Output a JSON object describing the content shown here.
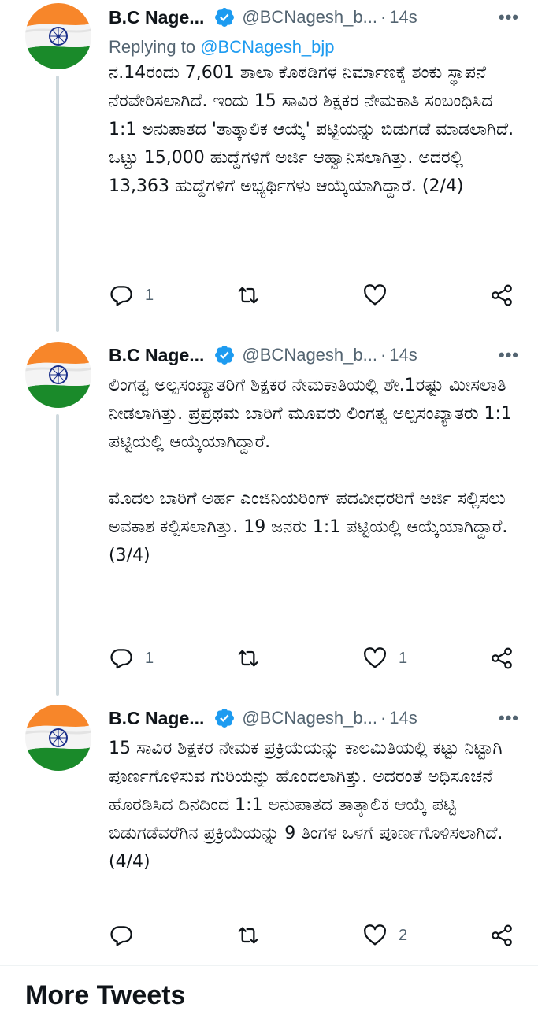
{
  "tweets": [
    {
      "name": "B.C Nage...",
      "handle": "@BCNagesh_b...",
      "separator": "·",
      "time": "14s",
      "more": "•••",
      "replying_prefix": "Replying to",
      "replying_handle": "@BCNagesh_bjp",
      "text": "ನ.14ರಂದು 7,601 ಶಾಲಾ ಕೊಠಡಿಗಳ ನಿರ್ಮಾಣಕ್ಕೆ ಶಂಕು ಸ್ಥಾಪನೆ ನೆರವೇರಿಸಲಾಗಿದೆ. ಇಂದು 15 ಸಾವಿರ ಶಿಕ್ಷಕರ ನೇಮಕಾತಿ ಸಂಬಂಧಿಸಿದ 1:1 ಅನುಪಾತದ 'ತಾತ್ಕಾಲಿಕ ಆಯ್ಕೆ' ಪಟ್ಟಿಯನ್ನು ಬಿಡುಗಡೆ ಮಾಡಲಾಗಿದೆ. ಒಟ್ಟು 15,000 ಹುದ್ದೆಗಳಿಗೆ ಅರ್ಜಿ ಆಹ್ವಾನಿಸಲಾಗಿತ್ತು. ಅದರಲ್ಲಿ 13,363 ಹುದ್ದೆಗಳಿಗೆ ಅಭ್ಯರ್ಥಿಗಳು ಆಯ್ಕೆಯಾಗಿದ್ದಾರೆ. (2/4)",
      "reply_count": "1",
      "retweet_count": "",
      "like_count": ""
    },
    {
      "name": "B.C Nage...",
      "handle": "@BCNagesh_b...",
      "separator": "·",
      "time": "14s",
      "more": "•••",
      "text": "ಲಿಂಗತ್ವ ಅಲ್ಪಸಂಖ್ಯಾತರಿಗೆ ಶಿಕ್ಷಕರ ನೇಮಕಾತಿಯಲ್ಲಿ ಶೇ.1ರಷ್ಟು ಮೀಸಲಾತಿ ನೀಡಲಾಗಿತ್ತು. ಪ್ರಪ್ರಥಮ ಬಾರಿಗೆ ಮೂವರು ಲಿಂಗತ್ವ ಅಲ್ಪಸಂಖ್ಯಾತರು 1:1 ಪಟ್ಟಿಯಲ್ಲಿ ಆಯ್ಕೆಯಾಗಿದ್ದಾರೆ.\n\nಮೊದಲ ಬಾರಿಗೆ ಅರ್ಹ ಎಂಜಿನಿಯರಿಂಗ್ ಪದವೀಧರರಿಗೆ ಅರ್ಜಿ ಸಲ್ಲಿಸಲು ಅವಕಾಶ ಕಲ್ಪಿಸಲಾಗಿತ್ತು. 19 ಜನರು 1:1 ಪಟ್ಟಿಯಲ್ಲಿ ಆಯ್ಕೆಯಾಗಿದ್ದಾರೆ. (3/4)",
      "reply_count": "1",
      "retweet_count": "",
      "like_count": "1"
    },
    {
      "name": "B.C Nage...",
      "handle": "@BCNagesh_b...",
      "separator": "·",
      "time": "14s",
      "more": "•••",
      "text": "15 ಸಾವಿರ ಶಿಕ್ಷಕರ ನೇಮಕ ಪ್ರಕ್ರಿಯೆಯನ್ನು ಕಾಲಮಿತಿಯಲ್ಲಿ ಕಟ್ಟು ನಿಟ್ಟಾಗಿ ಪೂರ್ಣಗೊಳಿಸುವ ಗುರಿಯನ್ನು ಹೊಂದಲಾಗಿತ್ತು. ಅದರಂತೆ ಅಧಿಸೂಚನೆ ಹೊರಡಿಸಿದ ದಿನದಿಂದ 1:1 ಅನುಪಾತದ ತಾತ್ಕಾಲಿಕ ಆಯ್ಕೆ ಪಟ್ಟಿ ಬಿಡುಗಡೆವರೆಗಿನ ಪ್ರಕ್ರಿಯೆಯನ್ನು 9 ತಿಂಗಳ ಒಳಗೆ ಪೂರ್ಣಗೊಳಿಸಲಾಗಿದೆ. (4/4)",
      "reply_count": "",
      "retweet_count": "",
      "like_count": "2"
    }
  ],
  "more_tweets_title": "More Tweets",
  "colors": {
    "accent": "#1d9bf0",
    "secondary_text": "#536471",
    "thread_line": "#cfd9de",
    "flag_saffron": "#ff9933",
    "flag_green": "#138808",
    "flag_chakra": "#000080"
  },
  "icons": [
    "verified-badge-icon",
    "reply-icon",
    "retweet-icon",
    "like-icon",
    "share-icon",
    "more-icon"
  ]
}
